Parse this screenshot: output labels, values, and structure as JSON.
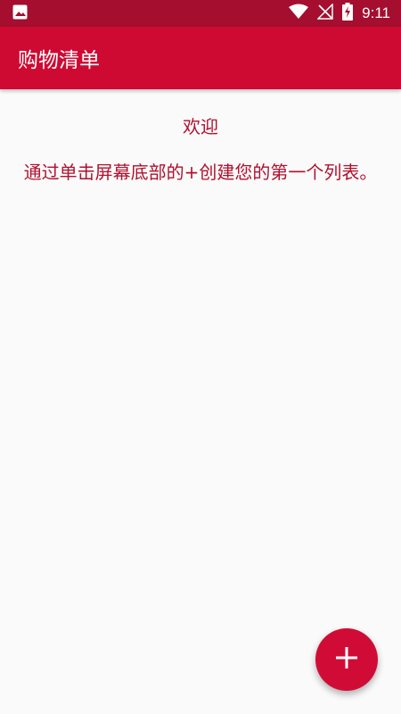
{
  "status_bar": {
    "time": "9:11",
    "icons": [
      "image-notification-icon",
      "wifi-icon",
      "no-signal-icon",
      "battery-charging-icon"
    ]
  },
  "app_bar": {
    "title": "购物清单"
  },
  "empty_state": {
    "welcome": "欢迎",
    "hint": "通过单击屏幕底部的+创建您的第一个列表。"
  },
  "fab": {
    "icon": "plus-icon"
  },
  "colors": {
    "status_bar": "#A50E2E",
    "app_bar": "#CE0A33",
    "accent_text": "#B0112F",
    "fab": "#D00C36",
    "background": "#FAFAFA"
  }
}
